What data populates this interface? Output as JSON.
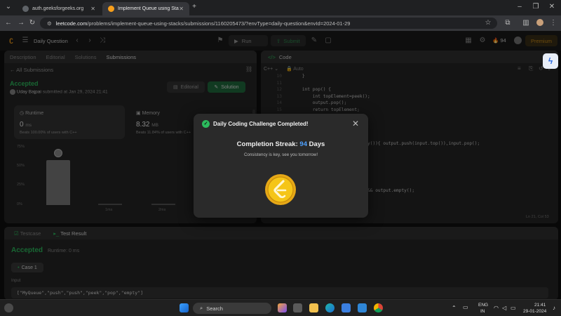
{
  "browser": {
    "tabs": [
      {
        "title": "auth.geeksforgeeks.org",
        "active": false
      },
      {
        "title": "Implement Queue using Stacks",
        "active": true
      }
    ],
    "url_host": "leetcode.com",
    "url_path": "/problems/implement-queue-using-stacks/submissions/1160205473/?envType=daily-question&envId=2024-01-29"
  },
  "header": {
    "daily_label": "Daily Question",
    "run_label": "Run",
    "submit_label": "Submit",
    "streak_count": "94",
    "premium_label": "Premium"
  },
  "left": {
    "tabs": [
      "Description",
      "Editorial",
      "Solutions",
      "Submissions"
    ],
    "back_label": "All Submissions",
    "status": "Accepted",
    "submitter": "Uday Bajpai",
    "submitted_text": "submitted at Jan 29, 2024 21:41",
    "editorial_btn": "Editorial",
    "solution_btn": "Solution",
    "runtime_label": "Runtime",
    "runtime_value": "0",
    "runtime_unit": "ms",
    "runtime_beats": "Beats 100.00% of users with C++",
    "memory_label": "Memory",
    "memory_value": "8.32",
    "memory_unit": "MB",
    "memory_beats": "Beats 11.84% of users with C++",
    "y_ticks": [
      "75%",
      "50%",
      "25%",
      "0%"
    ],
    "x_ticks": [
      "1ms",
      "2ms"
    ]
  },
  "code": {
    "tab_label": "Code",
    "language": "C++",
    "auto_label": "Auto",
    "lines": [
      {
        "n": "10",
        "text": "    }"
      },
      {
        "n": "11",
        "text": ""
      },
      {
        "n": "12",
        "text": "    int pop() {"
      },
      {
        "n": "13",
        "text": "        int topElement=peek();"
      },
      {
        "n": "14",
        "text": "        output.pop();"
      },
      {
        "n": "15",
        "text": "        return topElement;"
      },
      {
        "n": "16",
        "text": "    }"
      },
      {
        "n": "17",
        "text": ""
      },
      {
        "n": "18",
        "text": "    int peek() {"
      },
      {
        "n": "19",
        "text": "        if(output.empty()){"
      },
      {
        "n": "20",
        "text": "            while(!input.empty()){ output.push(input.top()),input.pop();"
      },
      {
        "n": "21",
        "text": "            }"
      },
      {
        "n": "22",
        "text": "        }"
      },
      {
        "n": "23",
        "text": "        return output.top();"
      },
      {
        "n": "24",
        "text": "    }"
      },
      {
        "n": "25",
        "text": ""
      },
      {
        "n": "26",
        "text": "    bool empty() {"
      },
      {
        "n": "27",
        "text": "        return input.empty() && output.empty();"
      },
      {
        "n": "28",
        "text": "    }"
      },
      {
        "n": "29",
        "text": "};"
      }
    ],
    "cursor_pos": "Ln 21, Col 53"
  },
  "bottom": {
    "tabs": [
      "Testcase",
      "Test Result"
    ],
    "result": "Accepted",
    "runtime_text": "Runtime: 0 ms",
    "case_label": "Case 1",
    "input_label": "Input",
    "input_value": "[\"MyQueue\",\"push\",\"push\",\"peek\",\"pop\",\"empty\"]"
  },
  "modal": {
    "title": "Daily Coding Challenge Completed!",
    "streak_prefix": "Completion Streak:",
    "streak_value": "94",
    "streak_suffix": "Days",
    "message": "Consistency is key, see you tomorrow!"
  },
  "taskbar": {
    "search_placeholder": "Search",
    "lang_line1": "ENG",
    "lang_line2": "IN",
    "time": "21:41",
    "date": "29-01-2024"
  },
  "colors": {
    "accent_green": "#2cbb5d",
    "streak_blue": "#4ea1ff",
    "premium_orange": "#c88a19",
    "coin_yellow": "#f5c518"
  }
}
